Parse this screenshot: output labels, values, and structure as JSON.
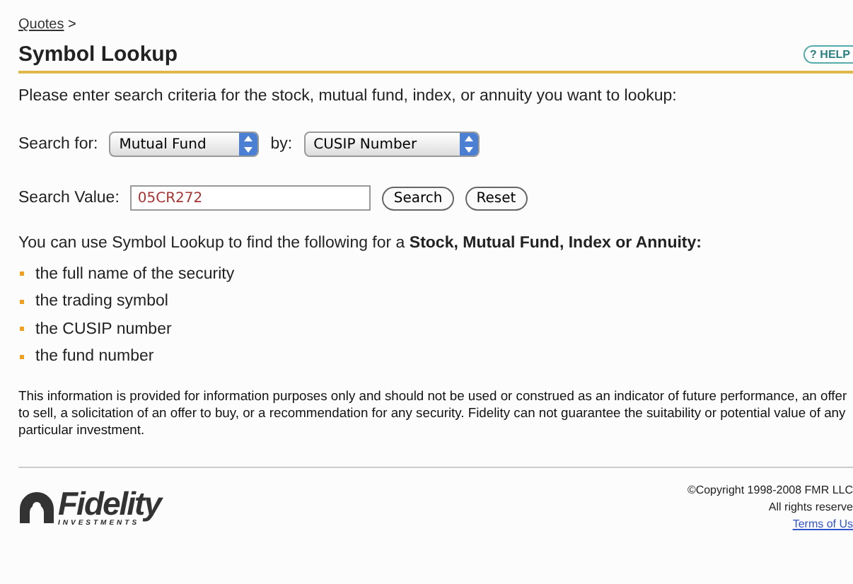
{
  "breadcrumb": {
    "link": "Quotes",
    "separator": ">"
  },
  "title": "Symbol Lookup",
  "help_button": "HELP",
  "help_icon": "?",
  "intro": "Please enter search criteria for the stock, mutual fund, index, or annuity you want to lookup:",
  "search_for": {
    "label": "Search for:",
    "value": "Mutual Fund"
  },
  "by": {
    "label": "by:",
    "value": "CUSIP Number"
  },
  "search_value": {
    "label": "Search Value:",
    "value": "05CR272"
  },
  "buttons": [
    "Search",
    "Reset"
  ],
  "features_intro": "You can use Symbol Lookup to find the following for a **Stock, Mutual Fund, Index or Annuity:**",
  "features": [
    "the full name of the security",
    "the trading symbol",
    "the CUSIP number",
    "the fund number"
  ],
  "disclaimer": "This information is provided for information purposes only and should not be used or construed as an indicator of future performance, an offer to sell, a solicitation of an offer to buy, or a recommendation for any security. Fidelity can not guarantee the suitability or potential value of any particular investment.",
  "footer": {
    "logo": "Fidelity",
    "logo_sub": "INVESTMENTS",
    "copyright": "©Copyright 1998-2008 FMR LLC",
    "rights": "All rights reserve",
    "terms_link": "Terms of Us"
  }
}
